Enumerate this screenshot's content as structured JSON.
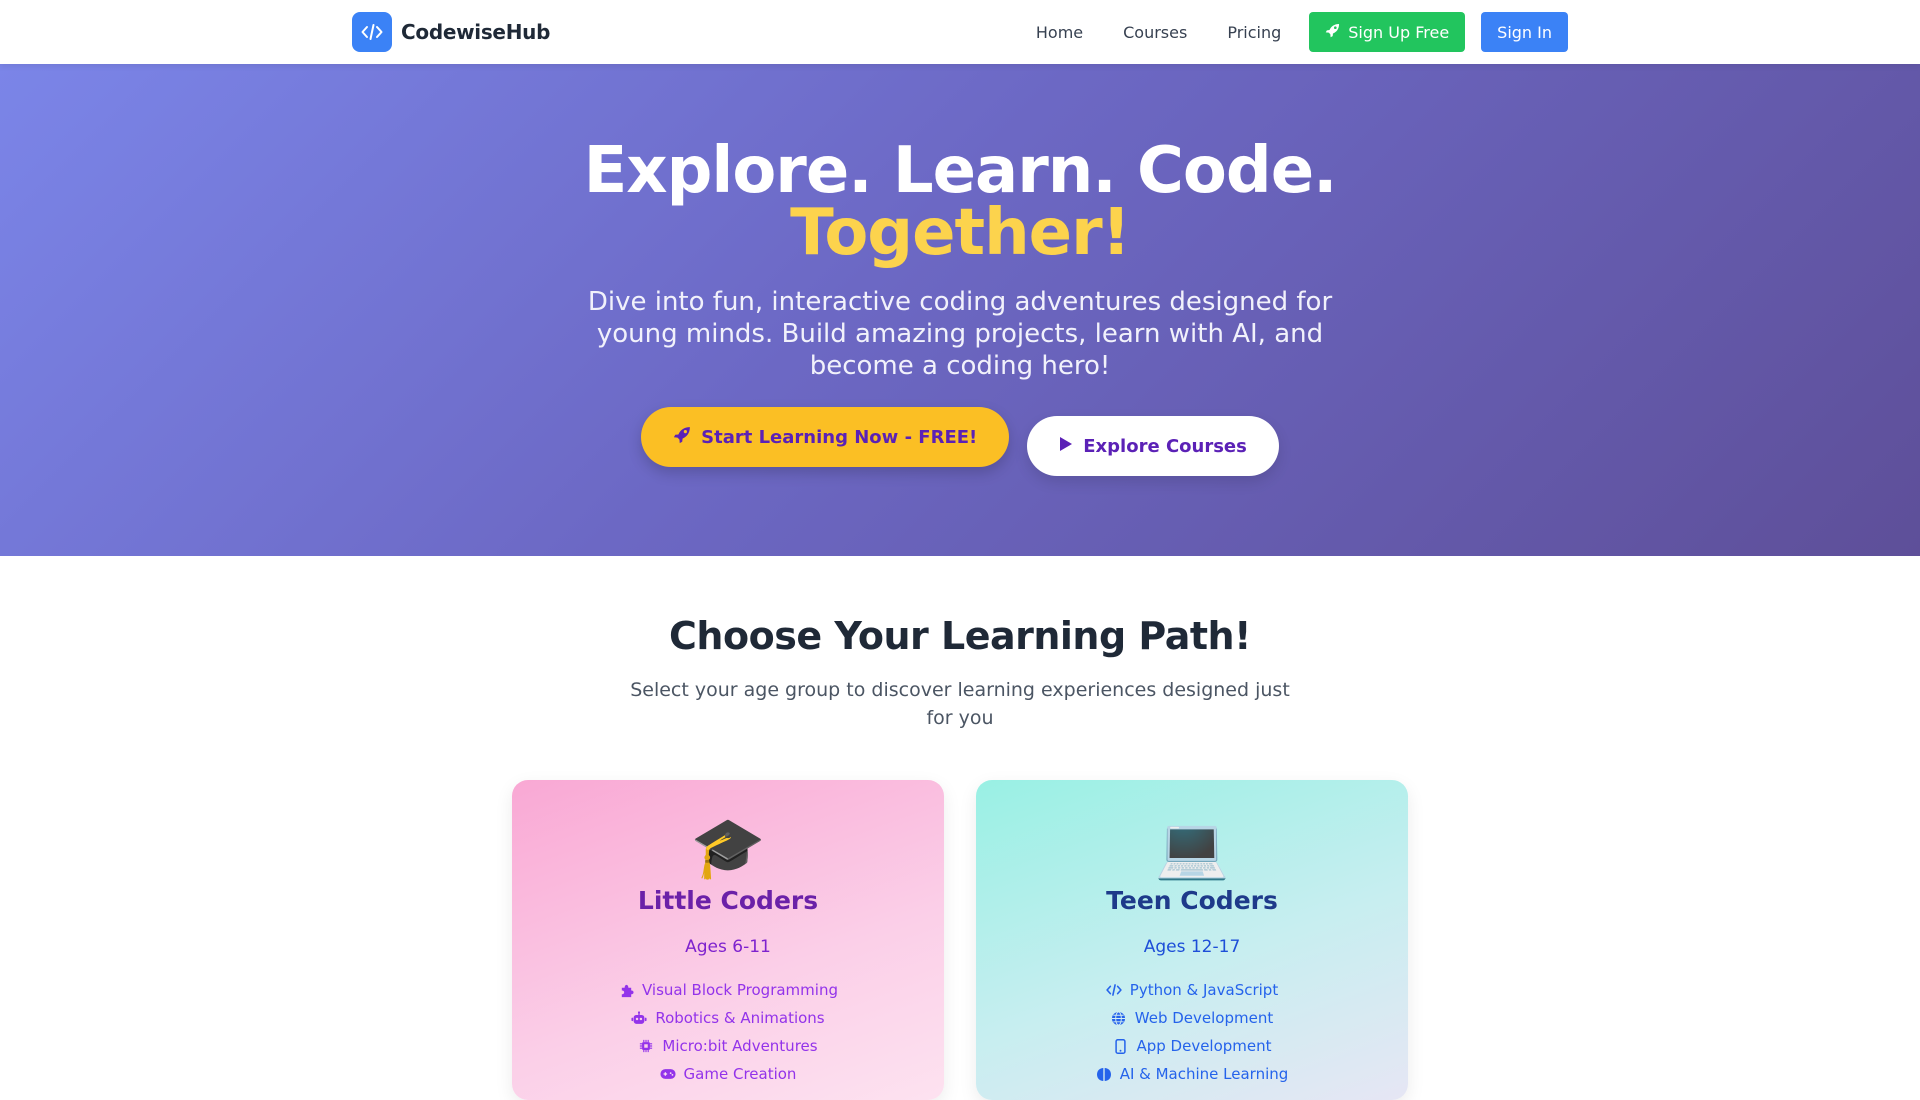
{
  "nav": {
    "brand": "CodewiseHub",
    "links": [
      "Home",
      "Courses",
      "Pricing"
    ],
    "signup_label": "Sign Up Free",
    "signin_label": "Sign In"
  },
  "hero": {
    "title_line1": "Explore. Learn. Code.",
    "title_line2": "Together!",
    "subtitle": "Dive into fun, interactive coding adventures designed for young minds. Build amazing projects, learn with AI, and become a coding hero!",
    "primary_cta": "Start Learning Now - FREE!",
    "secondary_cta": "Explore Courses"
  },
  "paths": {
    "title": "Choose Your Learning Path!",
    "subtitle": "Select your age group to discover learning experiences designed just for you",
    "cards": [
      {
        "emoji": "🎓",
        "title": "Little Coders",
        "ages": "Ages 6-11",
        "features": [
          {
            "icon": "puzzle-icon",
            "label": "Visual Block Programming"
          },
          {
            "icon": "robot-icon",
            "label": "Robotics & Animations"
          },
          {
            "icon": "microchip-icon",
            "label": "Micro:bit Adventures"
          },
          {
            "icon": "gamepad-icon",
            "label": "Game Creation"
          }
        ]
      },
      {
        "emoji": "💻",
        "title": "Teen Coders",
        "ages": "Ages 12-17",
        "features": [
          {
            "icon": "code-icon",
            "label": "Python & JavaScript"
          },
          {
            "icon": "globe-icon",
            "label": "Web Development"
          },
          {
            "icon": "mobile-icon",
            "label": "App Development"
          },
          {
            "icon": "brain-icon",
            "label": "AI & Machine Learning"
          }
        ]
      }
    ]
  },
  "colors": {
    "brand_blue": "#3b82f6",
    "signup_green": "#22c55e",
    "accent_yellow": "#fbbf24",
    "purple_text": "#5b21b6"
  }
}
